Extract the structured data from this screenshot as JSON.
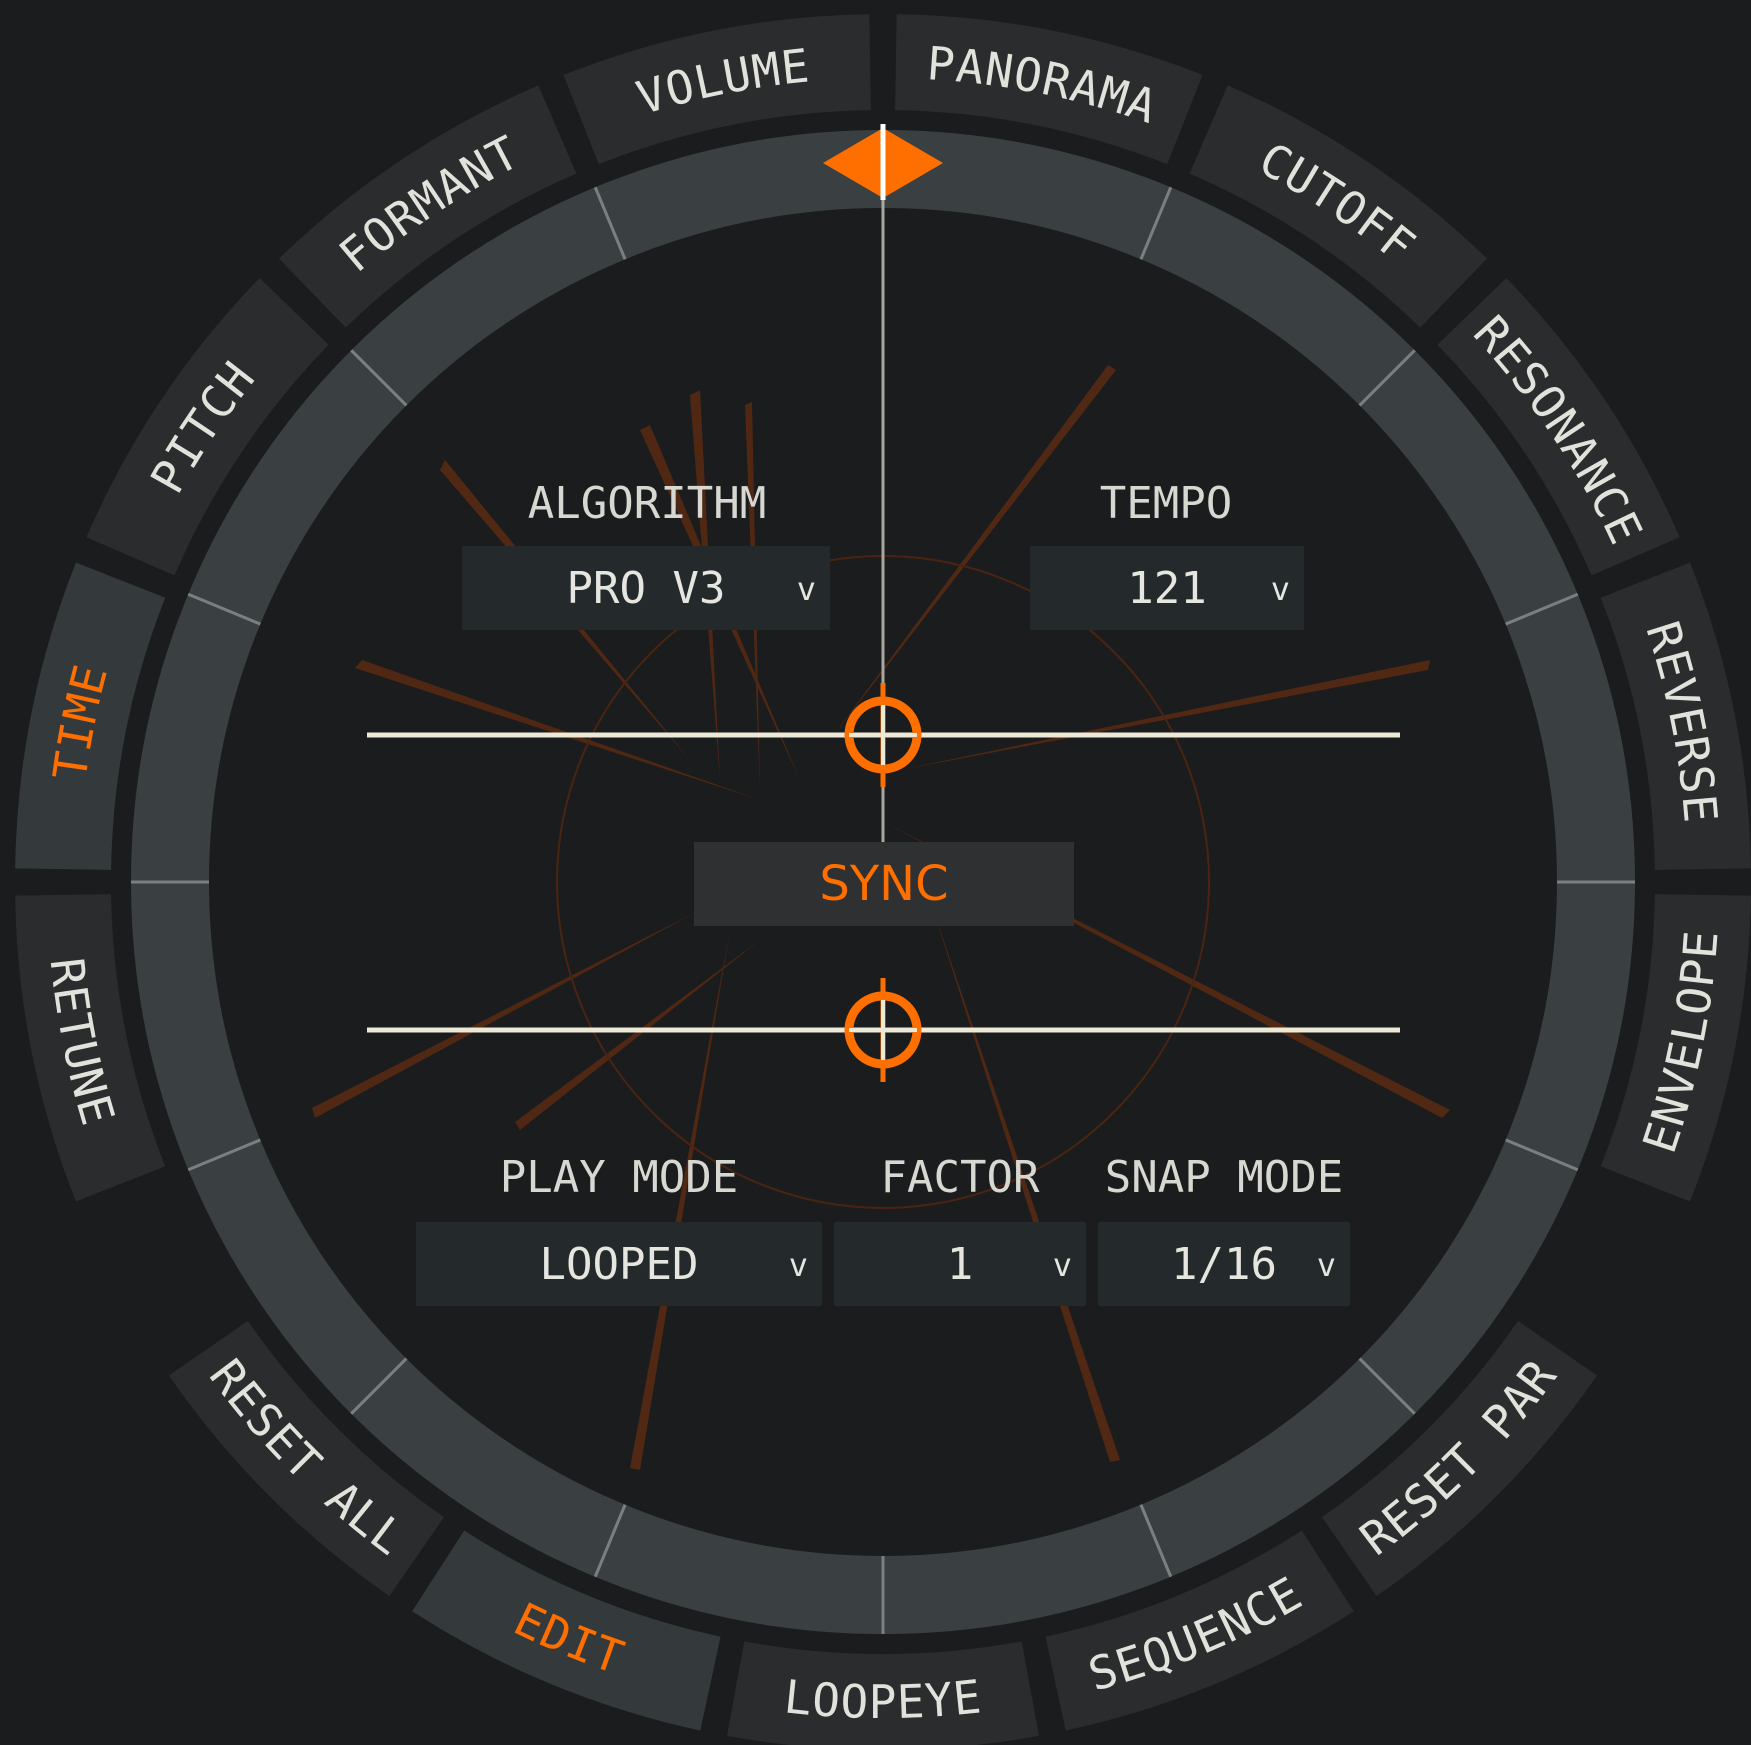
{
  "colors": {
    "background": "#1b1c1d",
    "segment_tab": "#2a2c2d",
    "segment_tab_active": "#343a3b",
    "ring_band": "#3a4042",
    "accent": "#ff6f00",
    "text": "#e2e2dc",
    "crosshair_line": "#ece9d6",
    "decor_spikes": "#5a2a12"
  },
  "ring_segments": [
    {
      "label": "VOLUME",
      "active": false
    },
    {
      "label": "PANORAMA",
      "active": false
    },
    {
      "label": "CUTOFF",
      "active": false
    },
    {
      "label": "RESONANCE",
      "active": false
    },
    {
      "label": "REVERSE",
      "active": false
    },
    {
      "label": "ENVELOPE",
      "active": false
    },
    {
      "label": "RESET PAR",
      "active": false
    },
    {
      "label": "SEQUENCE",
      "active": false
    },
    {
      "label": "LOOPEYE",
      "active": false
    },
    {
      "label": "EDIT",
      "active": true
    },
    {
      "label": "RESET ALL",
      "active": false
    },
    {
      "label": "RETUNE",
      "active": false
    },
    {
      "label": "TIME",
      "active": true
    },
    {
      "label": "PITCH",
      "active": false
    },
    {
      "label": "FORMANT",
      "active": false
    }
  ],
  "controls": {
    "algorithm": {
      "label": "ALGORITHM",
      "value": "PRO V3",
      "chevron": "v"
    },
    "tempo": {
      "label": "TEMPO",
      "value": "121",
      "chevron": "v"
    },
    "sync": {
      "label": "SYNC"
    },
    "play_mode": {
      "label": "PLAY MODE",
      "value": "LOOPED",
      "chevron": "v"
    },
    "factor": {
      "label": "FACTOR",
      "value": "1",
      "chevron": "v"
    },
    "snap_mode": {
      "label": "SNAP MODE",
      "value": "1/16",
      "chevron": "v"
    }
  },
  "icons": {
    "top_marker": "diamond-marker-icon",
    "crosshair": "crosshair-icon"
  }
}
